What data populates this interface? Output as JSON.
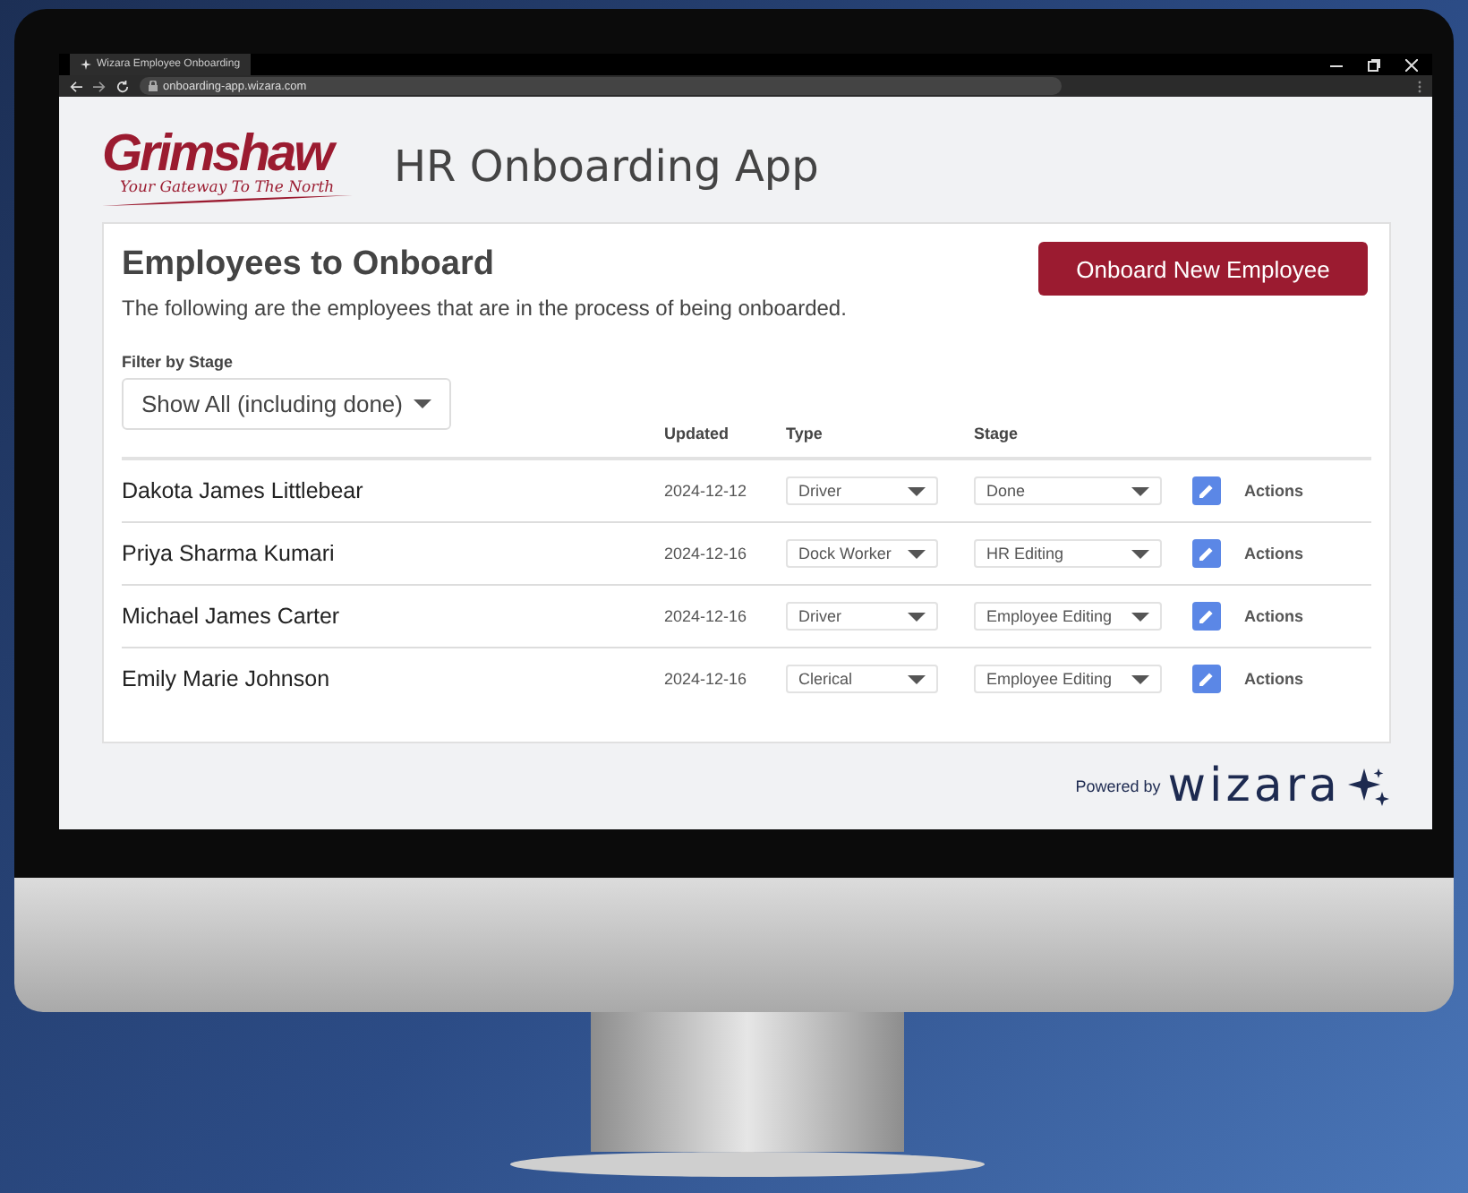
{
  "browser": {
    "tab_title": "Wizara Employee Onboarding",
    "url": "onboarding-app.wizara.com"
  },
  "header": {
    "logo_name": "Grimshaw",
    "logo_tagline": "Your Gateway To The North",
    "app_title": "HR Onboarding App"
  },
  "card": {
    "heading": "Employees to Onboard",
    "description": "The following are the employees that are in the process of being onboarded.",
    "primary_button": "Onboard New Employee",
    "filter": {
      "label": "Filter by Stage",
      "value": "Show All (including done)"
    },
    "table": {
      "columns": [
        "Updated",
        "Type",
        "Stage"
      ],
      "rows": [
        {
          "name": "Dakota James Littlebear",
          "updated": "2024-12-12",
          "type": "Driver",
          "stage": "Done",
          "action": "Actions"
        },
        {
          "name": "Priya Sharma Kumari",
          "updated": "2024-12-16",
          "type": "Dock Worker",
          "stage": "HR Editing",
          "action": "Actions"
        },
        {
          "name": "Michael James Carter",
          "updated": "2024-12-16",
          "type": "Driver",
          "stage": "Employee Editing",
          "action": "Actions"
        },
        {
          "name": "Emily Marie Johnson",
          "updated": "2024-12-16",
          "type": "Clerical",
          "stage": "Employee Editing",
          "action": "Actions"
        }
      ]
    }
  },
  "footer": {
    "powered_by": "Powered by",
    "brand": "wizara"
  }
}
